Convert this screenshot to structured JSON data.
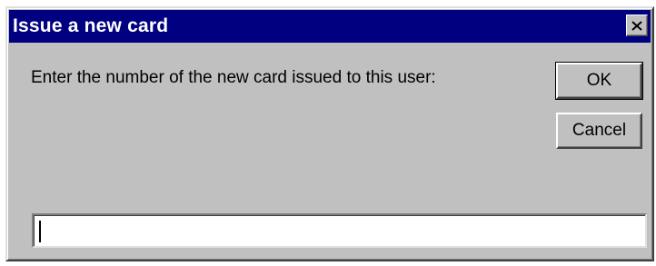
{
  "window": {
    "title": "Issue a new card",
    "close_label": "close"
  },
  "dialog": {
    "prompt": "Enter the number of the new card issued to this user:",
    "ok_label": "OK",
    "cancel_label": "Cancel",
    "input_value": ""
  },
  "colors": {
    "titlebar": "#000080",
    "face": "#c0c0c0",
    "field": "#ffffff"
  },
  "icons": {
    "close": "close-icon"
  }
}
